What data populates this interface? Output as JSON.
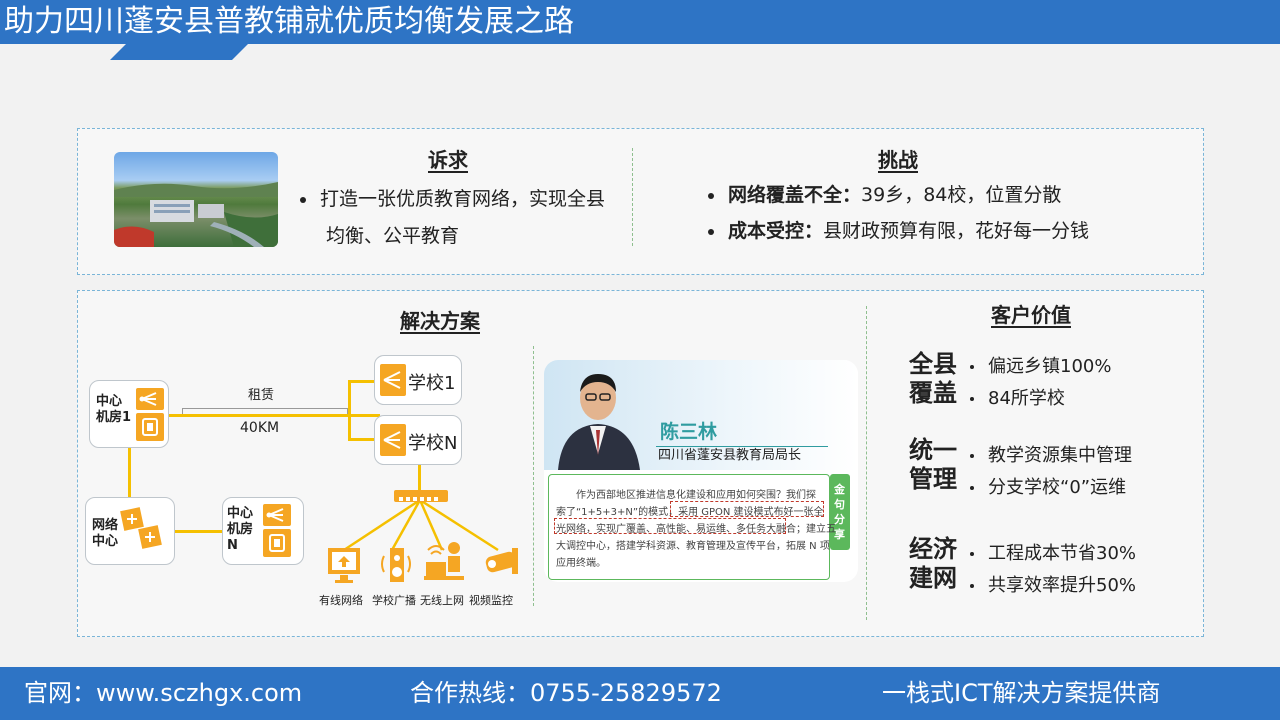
{
  "header": {
    "title": "助力四川蓬安县普教铺就优质均衡发展之路"
  },
  "demand": {
    "title": "诉求",
    "bullet_line1": "打造一张优质教育网络，实现全县",
    "bullet_line2": "均衡、公平教育"
  },
  "challenge": {
    "title": "挑战",
    "items": [
      {
        "bold": "网络覆盖不全：",
        "text": "39乡，84校，位置分散"
      },
      {
        "bold": "成本受控：",
        "text": "县财政预算有限，花好每一分钱"
      }
    ]
  },
  "solution": {
    "title": "解决方案",
    "center1": "中心\n机房1",
    "centerN": "中心\n机房\nN",
    "netcenter": "网络\n中心",
    "lease": "租赁",
    "distance": "40KM",
    "school1": "学校1",
    "schoolN": "学校N",
    "services": [
      "有线网络",
      "学校广播",
      "无线上网",
      "视频监控"
    ]
  },
  "quote": {
    "name": "陈三林",
    "role": "四川省蓬安县教育局局长",
    "tag": "金句分享",
    "lines": [
      "作为西部地区推进信息化建设和应用如何突围？我们探",
      "索了“1+5+3+N”的模式，采用 GPON 建设模式布好一张全",
      "光网络，实现广覆盖、高性能、易运维、多任务大融合；建立五",
      "大调控中心，搭建学科资源、教育管理及宣传平台，拓展 N 项",
      "应用终端。"
    ]
  },
  "value": {
    "title": "客户价值",
    "groups": [
      {
        "l1": "全县",
        "l2": "覆盖",
        "items": [
          "偏远乡镇100%",
          "84所学校"
        ]
      },
      {
        "l1": "统一",
        "l2": "管理",
        "items": [
          "教学资源集中管理",
          "分支学校“0”运维"
        ]
      },
      {
        "l1": "经济",
        "l2": "建网",
        "items": [
          "工程成本节省30%",
          "共享效率提升50%"
        ]
      }
    ]
  },
  "footer": {
    "site": "官网：www.sczhgx.com",
    "hotline": "合作热线：0755-25829572",
    "slogan": "一栈式ICT解决方案提供商"
  },
  "colors": {
    "brand": "#2e74c5",
    "accent": "#f5a623",
    "quote_name": "#2f9ca0",
    "tag_green": "#5cb85c"
  }
}
